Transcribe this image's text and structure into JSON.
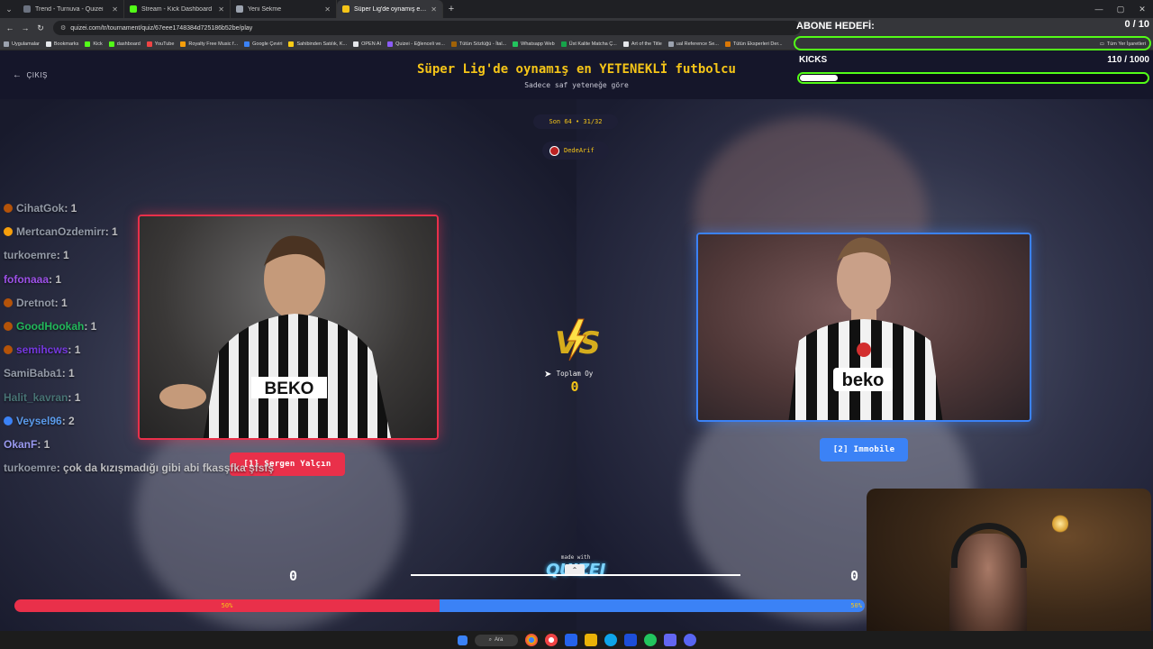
{
  "browser": {
    "tabs": [
      {
        "label": "Trend - Turnuva - Quizei",
        "color": "#6b7280",
        "active": false
      },
      {
        "label": "Stream - Kick Dashboard",
        "color": "#53fc18",
        "active": false
      },
      {
        "label": "Yeni Sekme",
        "color": "#9ca3af",
        "active": false
      },
      {
        "label": "Süper Lig'de oynamış en YETENE",
        "color": "#f5c518",
        "active": true
      }
    ],
    "new_tab": "+",
    "url": "quizei.com/tr/tournament/quiz/67eee1748384d725186b52be/play",
    "bookmarks": [
      {
        "label": "Uygulamalar",
        "color": "#9ca3af"
      },
      {
        "label": "Bookmarks",
        "color": "#e5e7eb"
      },
      {
        "label": "Kick",
        "color": "#53fc18"
      },
      {
        "label": "dashboard",
        "color": "#53fc18"
      },
      {
        "label": "YouTube",
        "color": "#ef4444"
      },
      {
        "label": "Royalty Free Music f...",
        "color": "#f59e0b"
      },
      {
        "label": "Google Çeviri",
        "color": "#3b82f6"
      },
      {
        "label": "Sahibinden Satılık, K...",
        "color": "#facc15"
      },
      {
        "label": "OPEN AI",
        "color": "#e5e7eb"
      },
      {
        "label": "Quizei - Eğlenceli ve...",
        "color": "#8b5cf6"
      },
      {
        "label": "Tütün Sözlüğü - İtal...",
        "color": "#a16207"
      },
      {
        "label": "Whatsapp Web",
        "color": "#22c55e"
      },
      {
        "label": "Üst Kalite Matcha Ç...",
        "color": "#16a34a"
      },
      {
        "label": "Art of the Title",
        "color": "#e5e7eb"
      },
      {
        "label": "ual Reference Se...",
        "color": "#9ca3af"
      },
      {
        "label": "Tütün Eksperleri Der...",
        "color": "#d97706"
      }
    ],
    "bookmarks_right": "Tüm Yer İşaretleri"
  },
  "header": {
    "exit_label": "ÇIKIŞ",
    "title": "Süper Lig'de oynamış en YETENEKLİ futbolcu",
    "subtitle": "Sadece saf yeteneğe göre"
  },
  "match": {
    "round": "Son 64 • 31/32",
    "user": "DedeArif",
    "left": {
      "label": "[1] Sergen Yalçın",
      "score": "0",
      "percent_label": "50%",
      "percent": 50
    },
    "right": {
      "label": "[2] Immobile",
      "score": "0",
      "percent_label": "50%",
      "percent": 50
    },
    "total_label": "Toplam Oy",
    "total_value": "0",
    "vs": "VS",
    "made_with": "made with",
    "logo": "QUIZEI"
  },
  "chat": [
    {
      "name": "CihatGok",
      "msg": ": 1",
      "color": "#9ca3af",
      "icon": "#b45309"
    },
    {
      "name": "MertcanOzdemirr",
      "msg": ": 1",
      "color": "#9ca3af",
      "icon": "#f59e0b"
    },
    {
      "name": "turkoemre",
      "msg": ": 1",
      "color": "#9ca3af",
      "icon": ""
    },
    {
      "name": "fofonaaa",
      "msg": ": 1",
      "color": "#a855f7",
      "icon": ""
    },
    {
      "name": "Dretnot",
      "msg": ": 1",
      "color": "#9ca3af",
      "icon": "#b45309"
    },
    {
      "name": "GoodHookah",
      "msg": ": 1",
      "color": "#22c55e",
      "icon": "#b45309"
    },
    {
      "name": "semihcws",
      "msg": ": 1",
      "color": "#7c3aed",
      "icon": "#b45309"
    },
    {
      "name": "SamiBaba1",
      "msg": ": 1",
      "color": "#9ca3af",
      "icon": ""
    },
    {
      "name": "Halit_kavran",
      "msg": ": 1",
      "color": "#4b7a7a",
      "icon": ""
    },
    {
      "name": "Veysel96",
      "msg": ": 2",
      "color": "#60a5fa",
      "icon": "#3b82f6"
    },
    {
      "name": "OkanF",
      "msg": ": 1",
      "color": "#a3a3ff",
      "icon": ""
    },
    {
      "name": "turkoemre",
      "msg": ": çok da kızışmadığı gibi abi fkasşfka şfsfş",
      "color": "#9ca3af",
      "icon": ""
    }
  ],
  "overlay": {
    "abone_title": "ABONE HEDEFİ:",
    "abone_count": "0 / 10",
    "kicks_label": "KICKS",
    "kicks_count": "110 / 1000",
    "kicks_progress": 0.11,
    "accent": "#53fc18"
  },
  "taskbar": {
    "search": "Ara"
  },
  "colors": {
    "red": "#e9304a",
    "blue": "#3b82f6",
    "gold": "#f5c518"
  }
}
